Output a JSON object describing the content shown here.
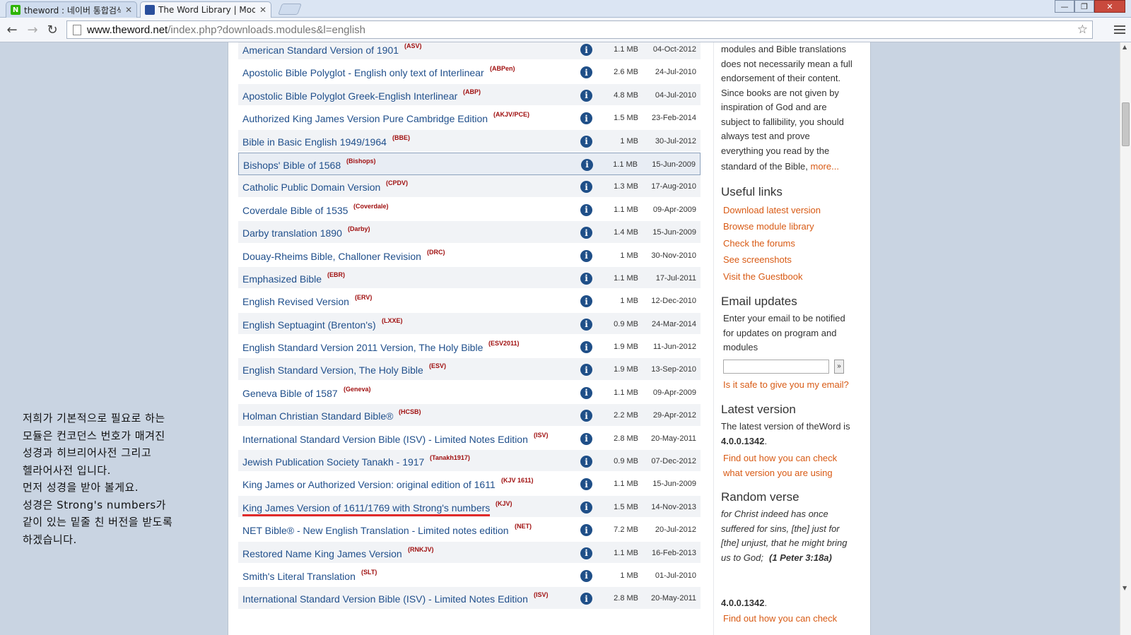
{
  "browser": {
    "tabs": [
      {
        "favicon": "naver-icon",
        "title": "theword : 네이버 통합검색",
        "active": false
      },
      {
        "favicon": "theword-book-icon",
        "title": "The Word Library | Modul",
        "active": true
      }
    ],
    "address": {
      "host": "www.theword.net",
      "path": "/index.php?downloads.modules&l=english"
    }
  },
  "modules": [
    {
      "name": "American Standard Version of 1901",
      "abbr": "(ASV)",
      "size": "1.1 MB",
      "date": "04-Oct-2012"
    },
    {
      "name": "Apostolic Bible Polyglot - English only text of Interlinear",
      "abbr": "(ABPen)",
      "size": "2.6 MB",
      "date": "24-Jul-2010"
    },
    {
      "name": "Apostolic Bible Polyglot Greek-English Interlinear",
      "abbr": "(ABP)",
      "size": "4.8 MB",
      "date": "04-Jul-2010"
    },
    {
      "name": "Authorized King James Version Pure Cambridge Edition",
      "abbr": "(AKJV/PCE)",
      "size": "1.5 MB",
      "date": "23-Feb-2014"
    },
    {
      "name": "Bible in Basic English 1949/1964",
      "abbr": "(BBE)",
      "size": "1 MB",
      "date": "30-Jul-2012"
    },
    {
      "name": "Bishops' Bible of 1568",
      "abbr": "(Bishops)",
      "size": "1.1 MB",
      "date": "15-Jun-2009"
    },
    {
      "name": "Catholic Public Domain Version",
      "abbr": "(CPDV)",
      "size": "1.3 MB",
      "date": "17-Aug-2010"
    },
    {
      "name": "Coverdale Bible of 1535",
      "abbr": "(Coverdale)",
      "size": "1.1 MB",
      "date": "09-Apr-2009"
    },
    {
      "name": "Darby translation 1890",
      "abbr": "(Darby)",
      "size": "1.4 MB",
      "date": "15-Jun-2009"
    },
    {
      "name": "Douay-Rheims Bible, Challoner Revision",
      "abbr": "(DRC)",
      "size": "1 MB",
      "date": "30-Nov-2010"
    },
    {
      "name": "Emphasized Bible",
      "abbr": "(EBR)",
      "size": "1.1 MB",
      "date": "17-Jul-2011"
    },
    {
      "name": "English Revised Version",
      "abbr": "(ERV)",
      "size": "1 MB",
      "date": "12-Dec-2010"
    },
    {
      "name": "English Septuagint (Brenton's)",
      "abbr": "(LXXE)",
      "size": "0.9 MB",
      "date": "24-Mar-2014"
    },
    {
      "name": "English Standard Version 2011 Version, The Holy Bible",
      "abbr": "(ESV2011)",
      "size": "1.9 MB",
      "date": "11-Jun-2012"
    },
    {
      "name": "English Standard Version, The Holy Bible",
      "abbr": "(ESV)",
      "size": "1.9 MB",
      "date": "13-Sep-2010"
    },
    {
      "name": "Geneva Bible of 1587",
      "abbr": "(Geneva)",
      "size": "1.1 MB",
      "date": "09-Apr-2009"
    },
    {
      "name": "Holman Christian Standard Bible®",
      "abbr": "(HCSB)",
      "size": "2.2 MB",
      "date": "29-Apr-2012"
    },
    {
      "name": "International Standard Version Bible (ISV) - Limited Notes Edition",
      "abbr": "(ISV)",
      "size": "2.8 MB",
      "date": "20-May-2011"
    },
    {
      "name": "Jewish Publication Society Tanakh - 1917",
      "abbr": "(Tanakh1917)",
      "size": "0.9 MB",
      "date": "07-Dec-2012"
    },
    {
      "name": "King James or Authorized Version: original edition of 1611",
      "abbr": "(KJV 1611)",
      "size": "1.1 MB",
      "date": "15-Jun-2009"
    },
    {
      "name": "King James Version of 1611/1769 with Strong's numbers",
      "abbr": "(KJV)",
      "size": "1.5 MB",
      "date": "14-Nov-2013"
    },
    {
      "name": "NET Bible® - New English Translation - Limited notes edition",
      "abbr": "(NET)",
      "size": "7.2 MB",
      "date": "20-Jul-2012"
    },
    {
      "name": "Restored Name King James Version",
      "abbr": "(RNKJV)",
      "size": "1.1 MB",
      "date": "16-Feb-2013"
    },
    {
      "name": "Smith's Literal Translation",
      "abbr": "(SLT)",
      "size": "1 MB",
      "date": "01-Jul-2010"
    },
    {
      "name": "International Standard Version Bible (ISV) - Limited Notes Edition",
      "abbr": "(ISV)",
      "size": "2.8 MB",
      "date": "20-May-2011"
    }
  ],
  "sidebar": {
    "intro_lines": [
      "modules and Bible translations",
      "does not necessarily mean a full",
      "endorsement of their content.",
      "Since books are not given by",
      "inspiration of God and are",
      "subject to fallibility, you should",
      "always test and prove",
      "everything you read by the"
    ],
    "intro_last": "standard of the Bible,",
    "more_link": "more...",
    "useful_links_title": "Useful links",
    "useful_links": [
      "Download latest version",
      "Browse module library",
      "Check the forums",
      "See screenshots",
      "Visit the Guestbook"
    ],
    "email_title": "Email updates",
    "email_lines": [
      "Enter your email to be notified",
      "for updates on program and",
      "modules"
    ],
    "email_button": "»",
    "email_safe_link": "Is it safe to give you my email?",
    "latest_title": "Latest version",
    "latest_text": "The latest version of theWord is",
    "latest_version": "4.0.0.1342",
    "latest_link_lines": [
      "Find out how you can check",
      "what version you are using"
    ],
    "verse_title": "Random verse",
    "verse_lines": [
      "for Christ indeed has once",
      "suffered for sins, [the] just for",
      "[the] unjust, that he might bring",
      "us to God;"
    ],
    "verse_ref": "(1 Peter 3:18a)",
    "repeat_version": "4.0.0.1342",
    "repeat_link": "Find out how you can check"
  },
  "note": {
    "lines": [
      "저희가 기본적으로 필요로 하는",
      "모듈은 컨코던스 번호가 매겨진",
      "성경과 히브리어사전 그리고",
      "헬라어사전 입니다.",
      "먼저 성경을 받아 볼게요.",
      "성경은 Strong's numbers가",
      "같이 있는 밑줄 친 버전을 받도록",
      "하겠습니다."
    ]
  },
  "colors": {
    "link": "#21508c",
    "abbr": "#a01010",
    "sidebar_link": "#d85a14",
    "underline": "#e02a2a"
  }
}
